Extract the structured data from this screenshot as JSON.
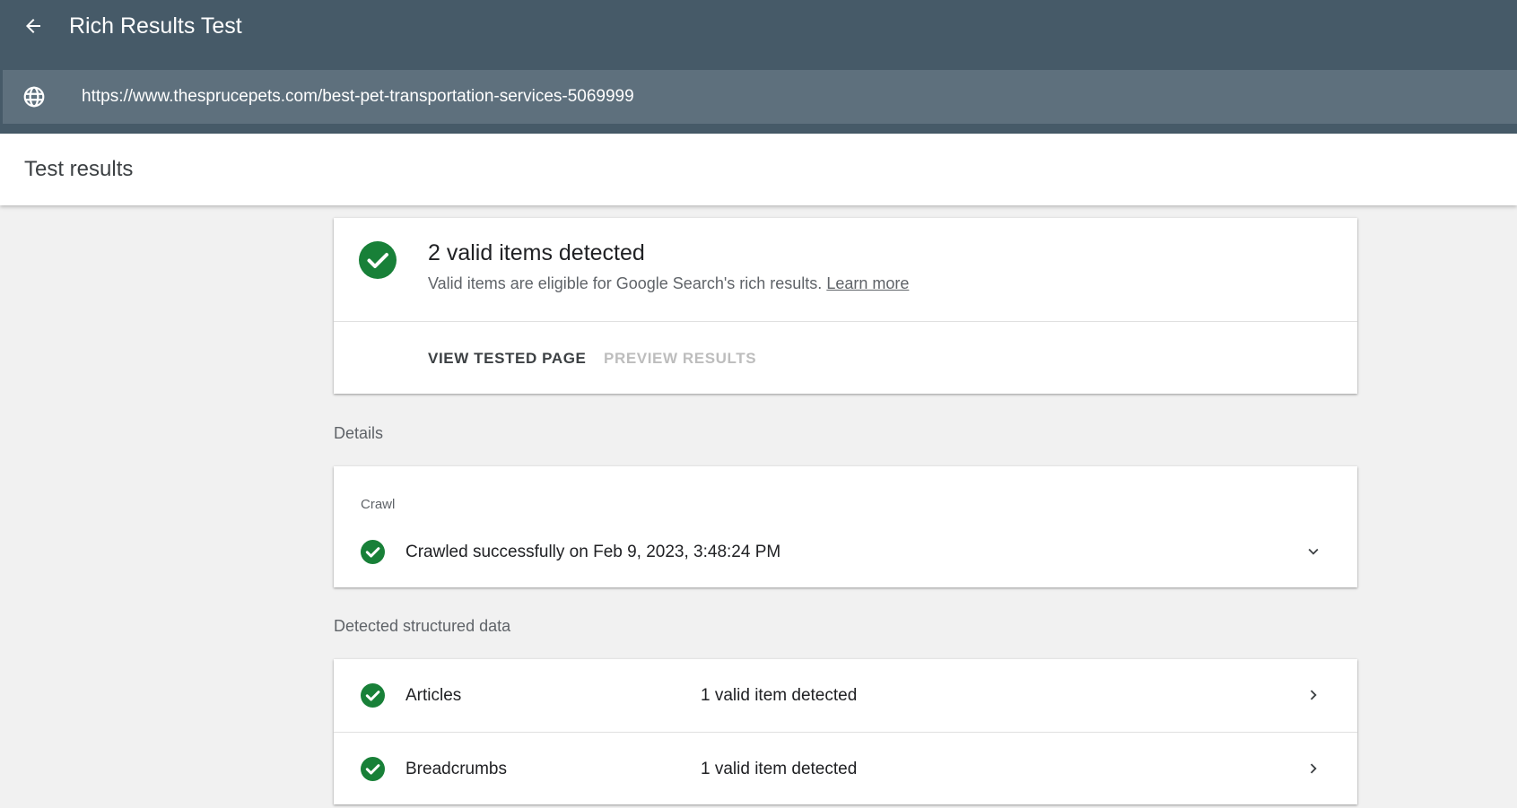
{
  "app": {
    "title": "Rich Results Test",
    "back_icon": "arrow-back-icon",
    "url": "https://www.thesprucepets.com/best-pet-transportation-services-5069999",
    "globe_icon": "globe-icon"
  },
  "results": {
    "title": "Test results"
  },
  "summary": {
    "title": "2 valid items detected",
    "subtitle": "Valid items are eligible for Google Search's rich results.",
    "learn_more": "Learn more",
    "view_tested_page": "VIEW TESTED PAGE",
    "preview_results": "PREVIEW RESULTS",
    "status_color": "#188038"
  },
  "details": {
    "label": "Details",
    "crawl_label": "Crawl",
    "crawl_status": "Crawled successfully on Feb 9, 2023, 3:48:24 PM"
  },
  "structured_data": {
    "label": "Detected structured data",
    "items": [
      {
        "name": "Articles",
        "status": "1 valid item detected"
      },
      {
        "name": "Breadcrumbs",
        "status": "1 valid item detected"
      }
    ]
  }
}
